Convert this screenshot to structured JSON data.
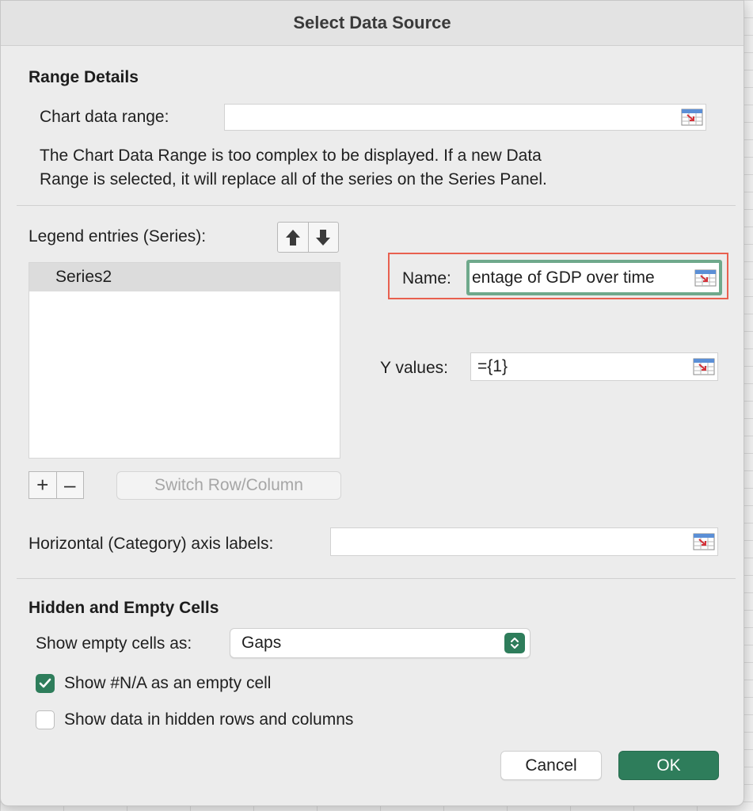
{
  "dialog": {
    "title": "Select Data Source"
  },
  "range_details": {
    "heading": "Range Details",
    "chart_data_range_label": "Chart data range:",
    "chart_data_range_value": "",
    "note_line1": "The Chart Data Range is too complex to be displayed. If a new Data",
    "note_line2": "Range is selected, it will replace all of the series on the Series Panel."
  },
  "series_panel": {
    "legend_label": "Legend entries (Series):",
    "items": [
      {
        "label": "Series2",
        "selected": true
      }
    ],
    "add_symbol": "+",
    "remove_symbol": "–",
    "switch_label": "Switch Row/Column",
    "name_label": "Name:",
    "name_value": "entage of GDP over time",
    "y_values_label": "Y values:",
    "y_values_value": "={1}"
  },
  "axis": {
    "label": "Horizontal (Category) axis labels:",
    "value": ""
  },
  "hidden_empty": {
    "heading": "Hidden and Empty Cells",
    "show_empty_label": "Show empty cells as:",
    "show_empty_value": "Gaps",
    "na_checkbox_label": "Show #N/A as an empty cell",
    "na_checked": true,
    "hidden_checkbox_label": "Show data in hidden rows and columns",
    "hidden_checked": false
  },
  "buttons": {
    "cancel": "Cancel",
    "ok": "OK"
  },
  "icons": {
    "range_picker": "range-picker-icon",
    "move_up": "arrow-up-icon",
    "move_down": "arrow-down-icon",
    "stepper": "chevron-updown-icon",
    "check": "checkmark-icon"
  },
  "colors": {
    "accent": "#2e7d5b",
    "highlight_box": "#e8604f",
    "focus_ring": "#6fa98c"
  }
}
